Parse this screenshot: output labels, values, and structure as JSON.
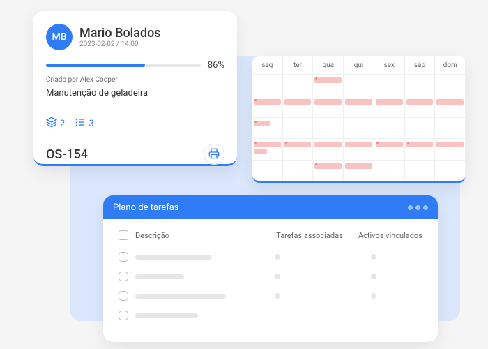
{
  "work_order": {
    "avatar_initials": "MB",
    "name": "Mario Bolados",
    "date": "2023-02-02 / 14:00",
    "progress_pct": 86,
    "created_by": "Criado por Alex Cooper",
    "title": "Manutenção de geladeira",
    "metric_layers": 2,
    "metric_tasks": 3,
    "code": "OS-154"
  },
  "calendar": {
    "days": [
      "seg",
      "ter",
      "qua",
      "qui",
      "sex",
      "sáb",
      "dom"
    ]
  },
  "tasks": {
    "title": "Plano de tarefas",
    "col_description": "Descrição",
    "col_linked_tasks": "Tarefas associadas",
    "col_linked_assets": "Activos vinculados"
  }
}
